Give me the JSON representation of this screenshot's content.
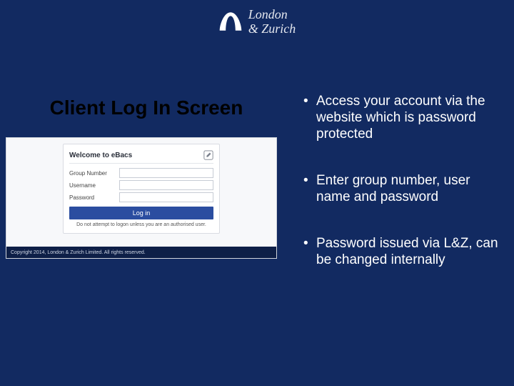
{
  "logo": {
    "line1": "London",
    "line2": "& Zurich"
  },
  "title": "Client Log In Screen",
  "screenshot": {
    "card_title": "Welcome to eBacs",
    "field1": "Group Number",
    "field2": "Username",
    "field3": "Password",
    "login": "Log in",
    "warning": "Do not attempt to logon unless you are an authorised user.",
    "footer": "Copyright 2014, London & Zurich Limited. All rights reserved."
  },
  "bullets": {
    "b1": "Access your account via the website which is password protected",
    "b2": "Enter group number, user name and password",
    "b3": "Password issued via L&Z, can be changed internally"
  }
}
